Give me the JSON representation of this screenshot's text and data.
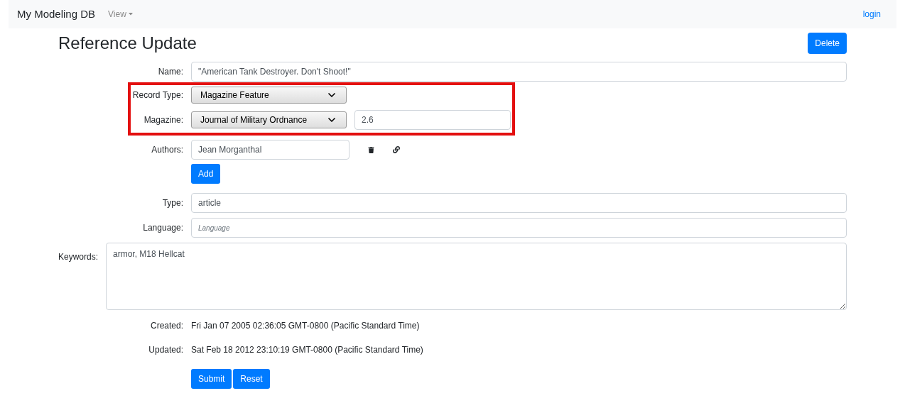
{
  "navbar": {
    "brand": "My Modeling DB",
    "menu": "View",
    "login": "login"
  },
  "title": "Reference Update",
  "delete_button": "Delete",
  "name": {
    "label": "Name:",
    "value": "\"American Tank Destroyer. Don't Shoot!\""
  },
  "record_type": {
    "label": "Record Type:",
    "value": "Magazine Feature"
  },
  "magazine": {
    "label": "Magazine:",
    "value": "Journal of Military Ordnance",
    "issue": "2.6"
  },
  "authors": {
    "label": "Authors:",
    "items": [
      {
        "name": "Jean Morganthal"
      }
    ],
    "add_button": "Add"
  },
  "type": {
    "label": "Type:",
    "value": "article"
  },
  "language": {
    "label": "Language:",
    "placeholder": "Language"
  },
  "keywords": {
    "label": "Keywords:",
    "value": "armor, M18 Hellcat"
  },
  "created": {
    "label": "Created:",
    "value": "Fri Jan 07 2005 02:36:05 GMT-0800 (Pacific Standard Time)"
  },
  "updated": {
    "label": "Updated:",
    "value": "Sat Feb 18 2012 23:10:19 GMT-0800 (Pacific Standard Time)"
  },
  "buttons": [
    "Submit",
    "Reset"
  ]
}
